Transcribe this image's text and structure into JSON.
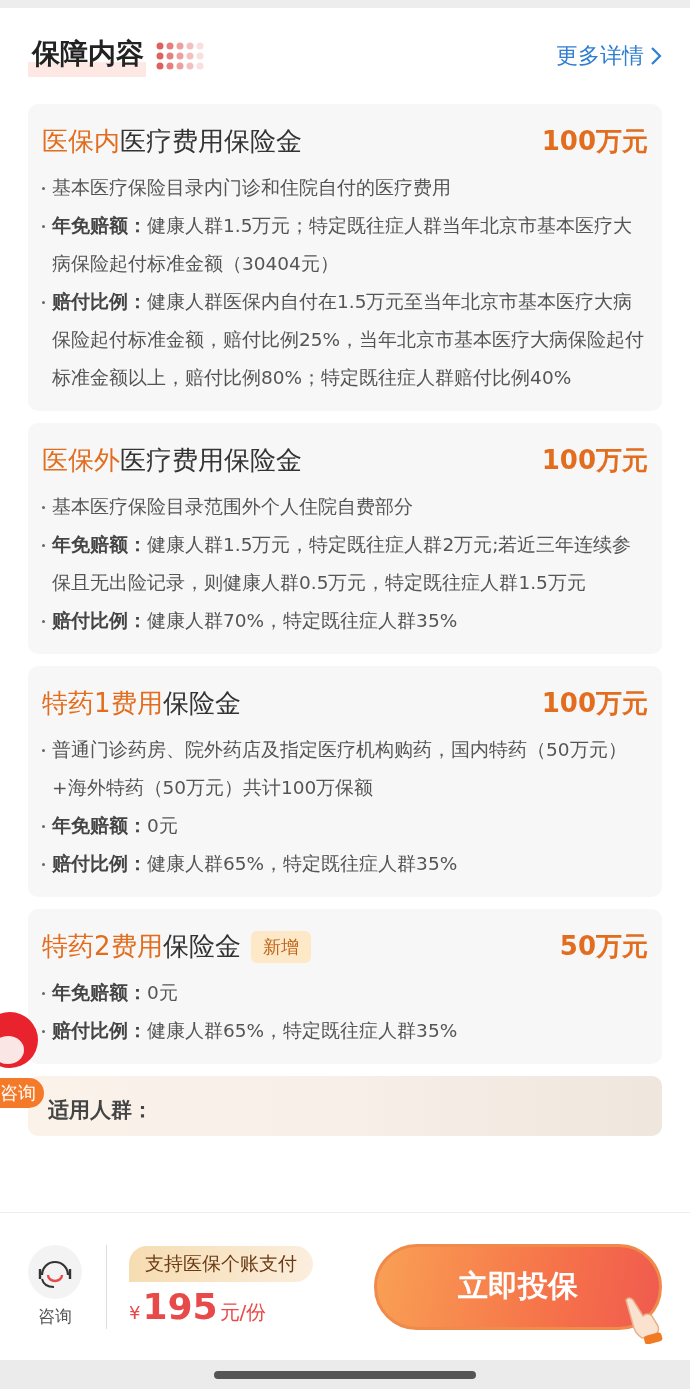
{
  "section": {
    "title": "保障内容",
    "more_link": "更多详情"
  },
  "cards": [
    {
      "highlight": "医保内",
      "title": "医疗费用保险金",
      "amount": "100万元",
      "items": [
        {
          "text": "基本医疗保险目录内门诊和住院自付的医疗费用"
        },
        {
          "label": "年免赔额：",
          "text": "健康人群1.5万元；特定既往症人群当年北京市基本医疗大病保险起付标准金额（30404元）"
        },
        {
          "label": "赔付比例：",
          "text": "健康人群医保内自付在1.5万元至当年北京市基本医疗大病保险起付标准金额，赔付比例25%，当年北京市基本医疗大病保险起付标准金额以上，赔付比例80%；特定既往症人群赔付比例40%"
        }
      ]
    },
    {
      "highlight": "医保外",
      "title": "医疗费用保险金",
      "amount": "100万元",
      "items": [
        {
          "text": "基本医疗保险目录范围外个人住院自费部分"
        },
        {
          "label": "年免赔额：",
          "text": "健康人群1.5万元，特定既往症人群2万元;若近三年连续参保且无出险记录，则健康人群0.5万元，特定既往症人群1.5万元"
        },
        {
          "label": "赔付比例：",
          "text": "健康人群70%，特定既往症人群35%"
        }
      ]
    },
    {
      "highlight": "特药1费用",
      "title": "保险金",
      "amount": "100万元",
      "items": [
        {
          "text": "普通门诊药房、院外药店及指定医疗机构购药，国内特药（50万元）+海外特药（50万元）共计100万保额"
        },
        {
          "label": "年免赔额：",
          "text": "0元"
        },
        {
          "label": "赔付比例：",
          "text": "健康人群65%，特定既往症人群35%"
        }
      ]
    },
    {
      "highlight": "特药2费用",
      "title": "保险金",
      "badge": "新增",
      "amount": "50万元",
      "items": [
        {
          "label": "年免赔额：",
          "text": "0元"
        },
        {
          "label": "赔付比例：",
          "text": "健康人群65%，特定既往症人群35%"
        }
      ]
    }
  ],
  "applicable": {
    "label": "适用人群："
  },
  "float_consult": {
    "label": "咨询"
  },
  "bottom_bar": {
    "consult_label": "咨询",
    "pay_note": "支持医保个账支付",
    "currency": "¥",
    "price": "195",
    "unit": "元/份",
    "buy_button": "立即投保"
  }
}
